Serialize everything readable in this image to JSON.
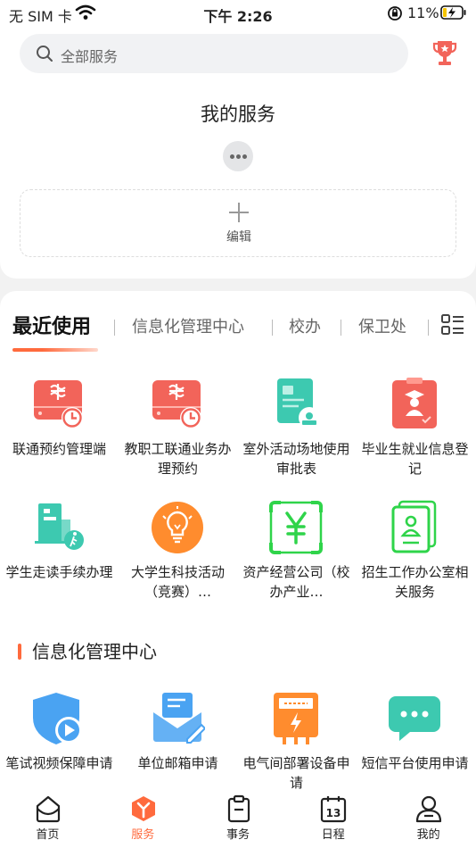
{
  "status_bar": {
    "carrier": "无 SIM 卡",
    "time": "下午 2:26",
    "battery": "11%"
  },
  "search": {
    "placeholder": "全部服务"
  },
  "my_services": {
    "title": "我的服务",
    "edit_label": "编辑"
  },
  "tabs": [
    "最近使用",
    "信息化管理中心",
    "校办",
    "保卫处"
  ],
  "recent_services": [
    {
      "label": "联通预约管理端",
      "icon": "unicom-clock-icon"
    },
    {
      "label": "教职工联通业务办理预约",
      "icon": "unicom-clock-icon"
    },
    {
      "label": "室外活动场地使用审批表",
      "icon": "approval-stamp-icon"
    },
    {
      "label": "毕业生就业信息登记",
      "icon": "graduate-badge-icon"
    },
    {
      "label": "学生走读手续办理",
      "icon": "building-walker-icon"
    },
    {
      "label": "大学生科技活动（竞赛）…",
      "icon": "lightbulb-icon"
    },
    {
      "label": "资产经营公司（校办产业…",
      "icon": "yuan-icon"
    },
    {
      "label": "招生工作办公室相关服务",
      "icon": "id-card-icon"
    }
  ],
  "section": {
    "title": "信息化管理中心",
    "items": [
      {
        "label": "笔试视频保障申请",
        "icon": "shield-play-icon"
      },
      {
        "label": "单位邮箱申请",
        "icon": "mail-pen-icon"
      },
      {
        "label": "电气间部署设备申请",
        "icon": "electric-meter-icon"
      },
      {
        "label": "短信平台使用申请",
        "icon": "chat-bubble-icon"
      }
    ]
  },
  "nav": [
    {
      "label": "首页",
      "icon": "home-icon"
    },
    {
      "label": "服务",
      "icon": "service-cube-icon"
    },
    {
      "label": "事务",
      "icon": "clipboard-icon"
    },
    {
      "label": "日程",
      "icon": "calendar-icon"
    },
    {
      "label": "我的",
      "icon": "person-icon"
    }
  ],
  "calendar_day": "13",
  "colors": {
    "accent": "#ff6a3d",
    "red_icon": "#f2645a",
    "teal_icon": "#3dc9b0",
    "orange_icon": "#ff8c2e",
    "green_icon": "#2fd44a",
    "blue_icon": "#4aa3f2"
  }
}
